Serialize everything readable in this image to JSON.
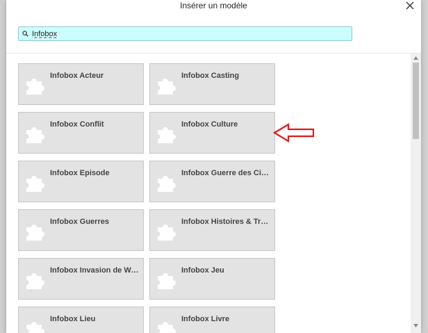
{
  "dialog": {
    "title": "Insérer un modèle",
    "close_icon": "close-icon"
  },
  "search": {
    "value": "Infobox",
    "icon": "search-icon"
  },
  "templates": [
    {
      "label": "Infobox Acteur"
    },
    {
      "label": "Infobox Casting"
    },
    {
      "label": "Infobox Conflit"
    },
    {
      "label": "Infobox Culture"
    },
    {
      "label": "Infobox Episode"
    },
    {
      "label": "Infobox Guerre des Cinq..."
    },
    {
      "label": "Infobox Guerres"
    },
    {
      "label": "Infobox Histoires & Tradi..."
    },
    {
      "label": "Infobox Invasion de Wes..."
    },
    {
      "label": "Infobox Jeu"
    },
    {
      "label": "Infobox Lieu"
    },
    {
      "label": "Infobox Livre"
    }
  ],
  "colors": {
    "search_bg": "#ccfeff",
    "tile_bg": "#e3e3e3",
    "annotation_arrow": "#e01a1a"
  }
}
